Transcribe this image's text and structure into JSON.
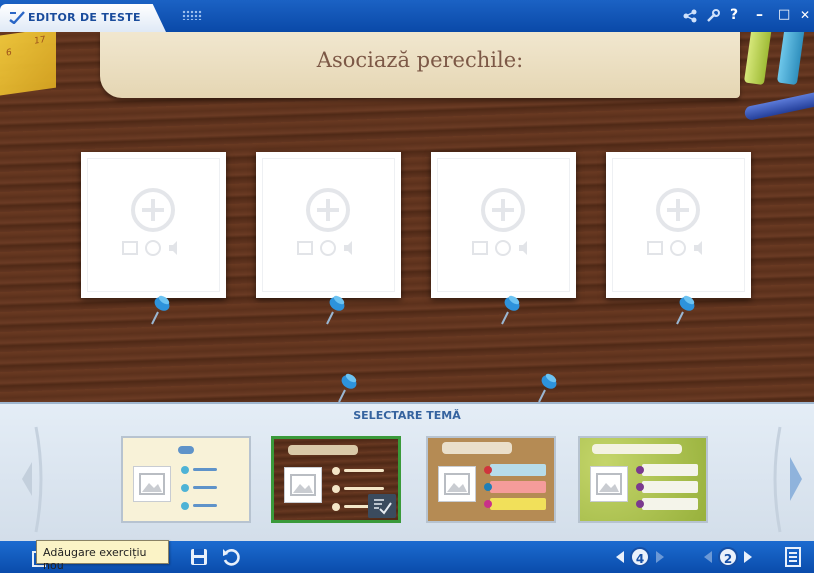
{
  "app": {
    "title": "EDITOR DE TESTE"
  },
  "window_controls": {
    "share": "share-icon",
    "tools": "tools-icon",
    "help": "?",
    "minimize": "–",
    "maximize": "□",
    "close": "✕"
  },
  "header": {
    "instruction": "Asociază perechile:"
  },
  "ruler_numbers": [
    "6",
    "17"
  ],
  "cards": [
    {
      "name": "card-1"
    },
    {
      "name": "card-2"
    },
    {
      "name": "card-3"
    },
    {
      "name": "card-4"
    }
  ],
  "theme_section": {
    "title": "SELECTARE TEMĂ",
    "themes": [
      {
        "name": "cream",
        "background": "#f8f2d8",
        "selected": false
      },
      {
        "name": "wood",
        "background": "#5a311e",
        "selected": true
      },
      {
        "name": "cork",
        "background": "#b58b54",
        "selected": false
      },
      {
        "name": "green",
        "background": "#a7bd4a",
        "selected": false
      }
    ]
  },
  "toolbar": {
    "tooltip": "Adăugare exercițiu nou",
    "exercise_count": "4",
    "page_number": "2"
  },
  "colors": {
    "accent_blue": "#0a4cab",
    "selection_green": "#3a9a3a",
    "pin_blue": "#2d93dc"
  }
}
